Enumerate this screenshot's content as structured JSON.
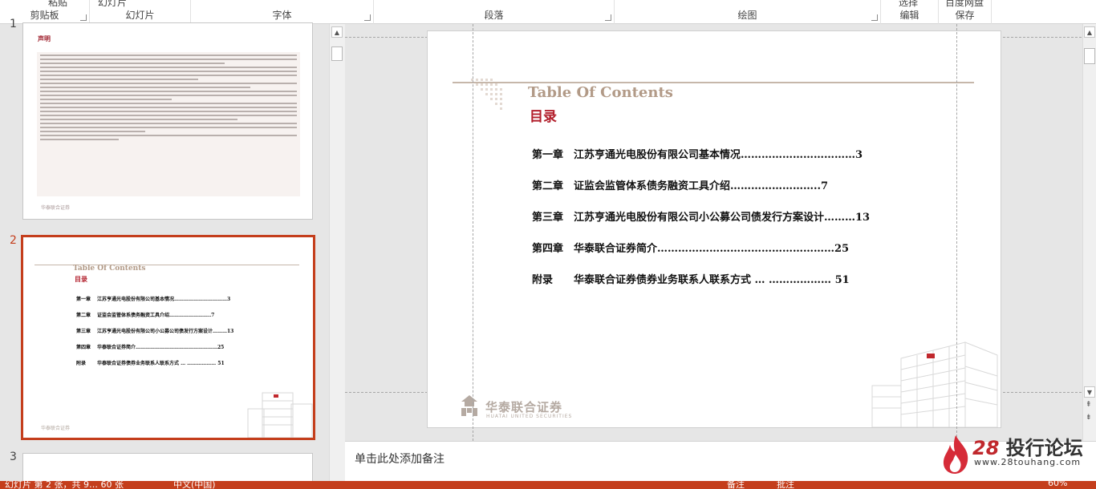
{
  "ribbon": {
    "groups": [
      {
        "label": "剪贴板",
        "cut": "粘贴"
      },
      {
        "label": "幻灯片",
        "cut": "幻灯片"
      },
      {
        "label": "字体",
        "cut": ""
      },
      {
        "label": "段落",
        "cut": ""
      },
      {
        "label": "绘图",
        "cut": ""
      },
      {
        "label": "编辑",
        "cut": "选择"
      },
      {
        "label": "保存",
        "cut": "百度网盘"
      }
    ]
  },
  "thumbnails": [
    {
      "number": "1",
      "title": "声明",
      "footer": "华泰联合证券"
    },
    {
      "number": "2",
      "title": "Table Of Contents",
      "subtitle": "目录",
      "footer": "华泰联合证券"
    },
    {
      "number": "3"
    }
  ],
  "slide": {
    "title": "Table Of Contents",
    "subtitle": "目录",
    "toc": [
      {
        "chapter": "第一章",
        "text": "江苏亨通光电股份有限公司基本情况……………………………3"
      },
      {
        "chapter": "第二章",
        "text": "证监会监管体系债务融资工具介绍……………………..7"
      },
      {
        "chapter": "第三章",
        "text": "江苏亨通光电股份有限公司小公募公司债发行方案设计………13"
      },
      {
        "chapter": "第四章",
        "text": "华泰联合证券简介……………………………………………25"
      },
      {
        "chapter": " 附录",
        "text": "华泰联合证券债券业务联系人联系方式 … ……………… 51"
      }
    ],
    "logo_cn": "华泰联合证券",
    "logo_en": "HUATAI UNITED SECURITIES"
  },
  "notes": {
    "placeholder": "单击此处添加备注"
  },
  "brand": {
    "number": "28",
    "name": "投行论坛",
    "url": "www.28touhang.com"
  },
  "status": {
    "slide_info": "幻灯片 第 2 张，共 9… 60 张",
    "language": "中文(中国)",
    "notes": "备注",
    "comments": "批注",
    "zoom": "60%"
  },
  "colors": {
    "accent": "#c43e1c",
    "toc_title": "#b29a87",
    "toc_sub": "#b21e2b"
  }
}
